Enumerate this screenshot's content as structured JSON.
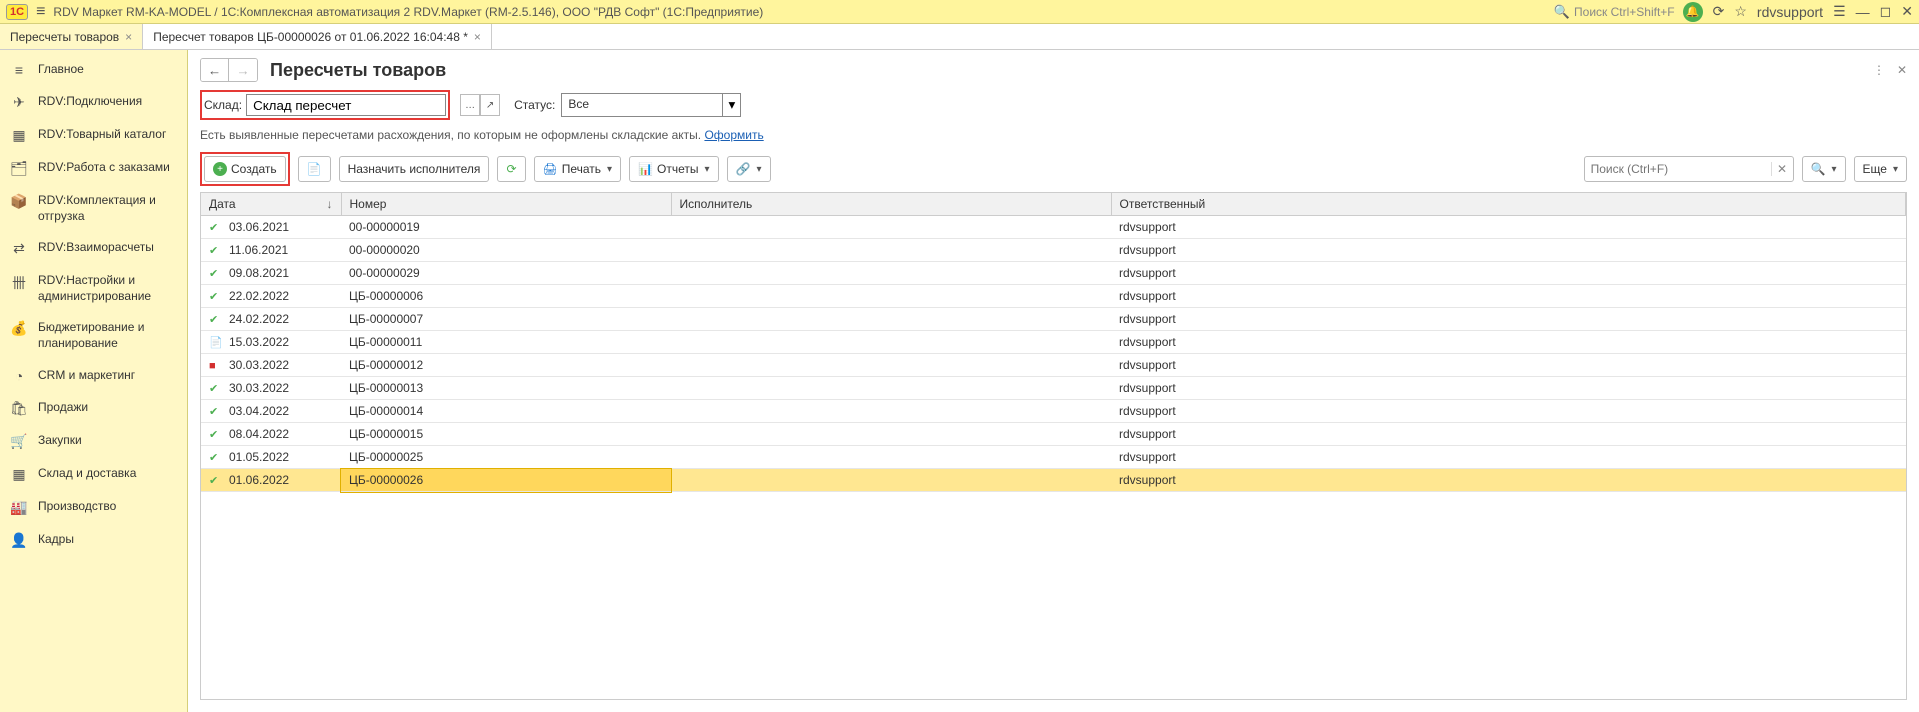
{
  "title_bar": {
    "logo": "1C",
    "title": "RDV Маркет RM-KA-MODEL / 1С:Комплексная автоматизация 2 RDV.Маркет (RM-2.5.146), ООО \"РДВ Софт\"  (1С:Предприятие)",
    "search_placeholder": "Поиск Ctrl+Shift+F",
    "username": "rdvsupport"
  },
  "tabs": [
    {
      "label": "Пересчеты товаров",
      "active": true
    },
    {
      "label": "Пересчет товаров ЦБ-00000026 от 01.06.2022 16:04:48 *",
      "active": false
    }
  ],
  "sidebar": [
    {
      "icon": "≡",
      "label": "Главное"
    },
    {
      "icon": "✈",
      "label": "RDV:Подключения"
    },
    {
      "icon": "▦",
      "label": "RDV:Товарный каталог"
    },
    {
      "icon": "🗂",
      "label": "RDV:Работа с заказами"
    },
    {
      "icon": "📦",
      "label": "RDV:Комплектация и отгрузка"
    },
    {
      "icon": "⇄",
      "label": "RDV:Взаиморасчеты"
    },
    {
      "icon": "卌",
      "label": "RDV:Настройки и администрирование"
    },
    {
      "icon": "💰",
      "label": "Бюджетирование и планирование"
    },
    {
      "icon": "◔",
      "label": "CRM и маркетинг"
    },
    {
      "icon": "🛍",
      "label": "Продажи"
    },
    {
      "icon": "🛒",
      "label": "Закупки"
    },
    {
      "icon": "▦",
      "label": "Склад и доставка"
    },
    {
      "icon": "🏭",
      "label": "Производство"
    },
    {
      "icon": "👤",
      "label": "Кадры"
    }
  ],
  "page": {
    "title": "Пересчеты товаров",
    "filters": {
      "sklad_label": "Склад:",
      "sklad_value": "Склад пересчет",
      "status_label": "Статус:",
      "status_value": "Все"
    },
    "warning_text": "Есть выявленные пересчетами расхождения, по которым не оформлены складские акты. ",
    "warning_link": "Оформить",
    "toolbar": {
      "create": "Создать",
      "assign": "Назначить исполнителя",
      "print": "Печать",
      "reports": "Отчеты",
      "search_placeholder": "Поиск (Ctrl+F)",
      "more": "Еще"
    },
    "columns": {
      "date": "Дата",
      "number": "Номер",
      "executor": "Исполнитель",
      "responsible": "Ответственный"
    },
    "rows": [
      {
        "date": "03.06.2021",
        "number": "00-00000019",
        "executor": "",
        "responsible": "rdvsupport",
        "icon": "ok"
      },
      {
        "date": "11.06.2021",
        "number": "00-00000020",
        "executor": "",
        "responsible": "rdvsupport",
        "icon": "ok"
      },
      {
        "date": "09.08.2021",
        "number": "00-00000029",
        "executor": "",
        "responsible": "rdvsupport",
        "icon": "ok"
      },
      {
        "date": "22.02.2022",
        "number": "ЦБ-00000006",
        "executor": "",
        "responsible": "rdvsupport",
        "icon": "ok"
      },
      {
        "date": "24.02.2022",
        "number": "ЦБ-00000007",
        "executor": "",
        "responsible": "rdvsupport",
        "icon": "ok"
      },
      {
        "date": "15.03.2022",
        "number": "ЦБ-00000011",
        "executor": "",
        "responsible": "rdvsupport",
        "icon": "doc"
      },
      {
        "date": "30.03.2022",
        "number": "ЦБ-00000012",
        "executor": "",
        "responsible": "rdvsupport",
        "icon": "red"
      },
      {
        "date": "30.03.2022",
        "number": "ЦБ-00000013",
        "executor": "",
        "responsible": "rdvsupport",
        "icon": "ok"
      },
      {
        "date": "03.04.2022",
        "number": "ЦБ-00000014",
        "executor": "",
        "responsible": "rdvsupport",
        "icon": "ok"
      },
      {
        "date": "08.04.2022",
        "number": "ЦБ-00000015",
        "executor": "",
        "responsible": "rdvsupport",
        "icon": "ok"
      },
      {
        "date": "01.05.2022",
        "number": "ЦБ-00000025",
        "executor": "",
        "responsible": "rdvsupport",
        "icon": "ok"
      },
      {
        "date": "01.06.2022",
        "number": "ЦБ-00000026",
        "executor": "",
        "responsible": "rdvsupport",
        "icon": "ok",
        "selected": true
      }
    ]
  }
}
